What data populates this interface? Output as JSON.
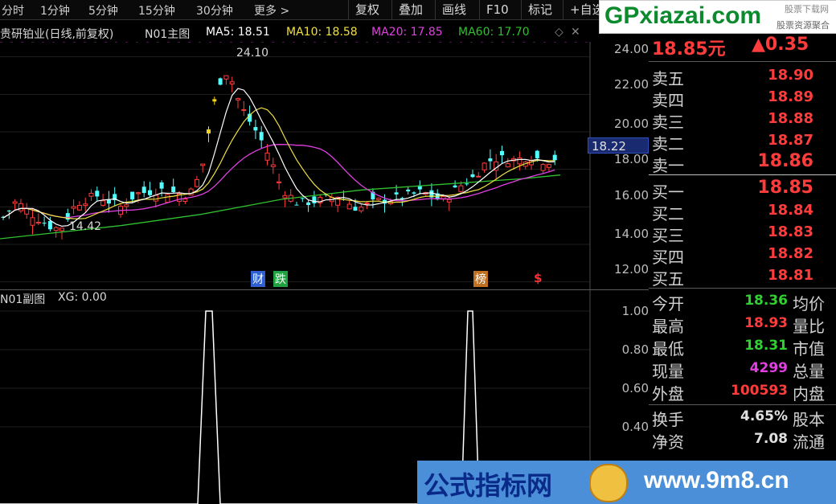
{
  "toolbar": {
    "timeframes": [
      "分时",
      "1分钟",
      "5分钟",
      "15分钟",
      "30分钟",
      "更多 >"
    ],
    "buttons": [
      "复权",
      "叠加",
      "画线",
      "F10",
      "标记",
      "+自选"
    ]
  },
  "main_chart": {
    "title": "贵研铂业(日线,前复权)",
    "indicator": "N01主图",
    "ma": [
      {
        "label": "MA5: 18.51",
        "color": "#ffffff"
      },
      {
        "label": "MA10: 18.58",
        "color": "#f0e040"
      },
      {
        "label": "MA20: 17.85",
        "color": "#e040e0"
      },
      {
        "label": "MA60: 17.70",
        "color": "#30c030"
      }
    ],
    "y_ticks": [
      "24.00",
      "22.00",
      "20.00",
      "18.00",
      "16.00",
      "14.00",
      "12.00"
    ],
    "y_range": [
      11.6,
      24.8
    ],
    "high_label": "24.10",
    "low_label": "14.42",
    "crosshair_price": "18.22",
    "event_tags": [
      {
        "text": "财",
        "color": "#3060d0"
      },
      {
        "text": "跌",
        "color": "#20a040"
      },
      {
        "text": "榜",
        "color": "#c07020"
      },
      {
        "text": "$",
        "color": "#ff3030"
      }
    ]
  },
  "sub_chart": {
    "title": "N01副图",
    "xg_label": "XG: 0.00",
    "y_ticks": [
      "1.00",
      "0.80",
      "0.60",
      "0.40"
    ],
    "signal_peaks": [
      1,
      1
    ]
  },
  "quote": {
    "price": "18.85元",
    "change": "▲0.35"
  },
  "order_book": {
    "asks": [
      {
        "label": "卖五",
        "price": "18.90"
      },
      {
        "label": "卖四",
        "price": "18.89"
      },
      {
        "label": "卖三",
        "price": "18.88"
      },
      {
        "label": "卖二",
        "price": "18.87"
      },
      {
        "label": "卖一",
        "price": "18.86"
      }
    ],
    "bids": [
      {
        "label": "买一",
        "price": "18.85"
      },
      {
        "label": "买二",
        "price": "18.84"
      },
      {
        "label": "买三",
        "price": "18.83"
      },
      {
        "label": "买四",
        "price": "18.82"
      },
      {
        "label": "买五",
        "price": "18.81"
      }
    ]
  },
  "stats": [
    {
      "label": "今开",
      "value": "18.36",
      "color": "#30d030",
      "label2": "均价"
    },
    {
      "label": "最高",
      "value": "18.93",
      "color": "#ff3c3c",
      "label2": "量比"
    },
    {
      "label": "最低",
      "value": "18.31",
      "color": "#30d030",
      "label2": "市值"
    },
    {
      "label": "现量",
      "value": "4299",
      "color": "#e040e0",
      "label2": "总量"
    },
    {
      "label": "外盘",
      "value": "100593",
      "color": "#ff3c3c",
      "label2": "内盘"
    },
    {
      "label": "换手",
      "value": "4.65%",
      "color": "#e0e0e0",
      "label2": "股本"
    },
    {
      "label": "净资",
      "value": "7.08",
      "color": "#e0e0e0",
      "label2": "流通"
    }
  ],
  "watermarks": {
    "top_site": "GPxiazai.com",
    "top_sub": "股票下载网",
    "top_sub2": "股票资源聚合",
    "bottom_text": "公式指标网",
    "bottom_url": "www.9m8.cn"
  }
}
